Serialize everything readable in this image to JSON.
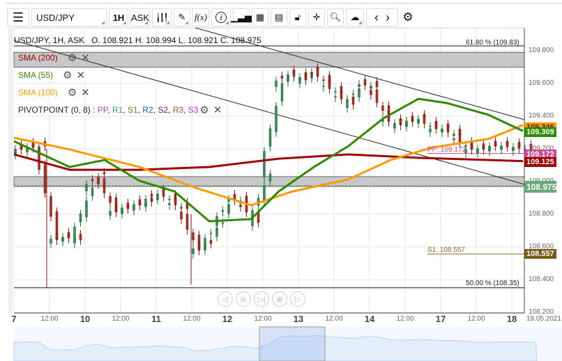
{
  "toolbar": {
    "menu_icon": "hamburger-icon",
    "symbol": "USD/JPY",
    "timeframe": "1H",
    "price_side": "ASK",
    "icons": [
      "candle-type-icon",
      "draw-pencil-icon",
      "function-fx-icon",
      "info-icon",
      "volume-bars-icon",
      "calendar-icon",
      "report-icon",
      "lock-icon",
      "crosshair-icon",
      "zoom-search-icon",
      "cloud-upload-icon",
      "chevron-left-icon",
      "chevron-right-icon",
      "gear-icon"
    ],
    "fx_label": "f(x)",
    "info_label": "i"
  },
  "header": {
    "text": "USD/JPY, 1H, ASK   O. 108.921 H. 108.994 L. 108.921 C. 108.975"
  },
  "indicators": [
    {
      "label": "SMA (200)",
      "color": "#a00000"
    },
    {
      "label": "SMA (55)",
      "color": "#2e8b00"
    },
    {
      "label": "SMA (100)",
      "color": "#ff9900"
    }
  ],
  "pivot": {
    "label": "PIVOTPOINT (0, 8)",
    "sep": " : ",
    "items": [
      {
        "t": "PP",
        "c": "#d040a0"
      },
      {
        "t": "R1",
        "c": "#2aa070"
      },
      {
        "t": "S1",
        "c": "#8a6a20"
      },
      {
        "t": "R2",
        "c": "#2050c0"
      },
      {
        "t": "S2",
        "c": "#602060"
      },
      {
        "t": "R3",
        "c": "#a06020"
      },
      {
        "t": "S3",
        "c": "#d020d0"
      }
    ]
  },
  "fib": {
    "top": "61.80 % (109.83)",
    "bottom": "50.00 % (108.35)"
  },
  "pivot_labels": {
    "pp": "PP: 109.172",
    "s1": "S1: 108.557"
  },
  "price_tags": [
    {
      "v": "109.346",
      "c": "#ff9900",
      "fg": "#333"
    },
    {
      "v": "109.309",
      "c": "#2e8b00",
      "fg": "#fff"
    },
    {
      "v": "109.172",
      "c": "#c84896",
      "fg": "#fff"
    },
    {
      "v": "109.125",
      "c": "#a00000",
      "fg": "#fff"
    },
    {
      "v": "108.975",
      "c": "#6aa87a",
      "fg": "#fff"
    },
    {
      "v": "108.557",
      "c": "#7a5a1a",
      "fg": "#fff"
    }
  ],
  "y_ticks": [
    "109.800",
    "109.600",
    "109.400",
    "109.200",
    "109.000",
    "108.800",
    "108.600",
    "108.400",
    "108.200"
  ],
  "x_ticks": [
    {
      "t": "7",
      "d": true
    },
    {
      "t": "12:00"
    },
    {
      "t": "10",
      "d": true
    },
    {
      "t": "12:00"
    },
    {
      "t": "11",
      "d": true
    },
    {
      "t": "12:00"
    },
    {
      "t": "12",
      "d": true
    },
    {
      "t": "12:00"
    },
    {
      "t": "13",
      "d": true
    },
    {
      "t": "12:00"
    },
    {
      "t": "14",
      "d": true
    },
    {
      "t": "12:00"
    },
    {
      "t": "17",
      "d": true
    },
    {
      "t": "12:00"
    },
    {
      "t": "18",
      "d": true
    },
    {
      "t": "18.05.2021"
    }
  ],
  "navigation": [
    "scroll-left-icon",
    "zoom-out-icon",
    "reset-end-icon",
    "zoom-in-icon",
    "scroll-right-icon"
  ],
  "chart_data": {
    "type": "candlestick",
    "symbol": "USD/JPY",
    "timeframe": "1H",
    "ylim": [
      108.2,
      109.85
    ],
    "step_hours": 4,
    "closes": [
      109.196,
      109.208,
      109.217,
      108.643,
      108.664,
      108.643,
      108.962,
      109.047,
      108.813,
      108.834,
      108.855,
      108.877,
      108.94,
      108.877,
      108.834,
      108.579,
      108.621,
      108.749,
      108.898,
      108.877,
      108.749,
      109.047,
      109.6,
      109.664,
      109.621,
      109.685,
      109.6,
      109.536,
      109.472,
      109.6,
      109.579,
      109.387,
      109.345,
      109.366,
      109.387,
      109.323,
      109.323,
      109.281,
      109.196,
      109.196,
      109.217,
      109.217,
      109.208,
      109.196
    ],
    "sma200": [
      [
        0,
        109.166
      ],
      [
        18.8,
        109.072
      ],
      [
        42.4,
        109.072
      ],
      [
        65.9,
        109.089
      ],
      [
        89.4,
        109.14
      ],
      [
        112.9,
        109.166
      ],
      [
        136.5,
        109.145
      ],
      [
        171.8,
        109.125
      ]
    ],
    "sma55": [
      [
        0,
        109.247
      ],
      [
        18.8,
        109.089
      ],
      [
        30.6,
        109.132
      ],
      [
        42.4,
        109.004
      ],
      [
        54.1,
        108.94
      ],
      [
        65.9,
        108.757
      ],
      [
        80,
        108.77
      ],
      [
        89.4,
        108.94
      ],
      [
        101.2,
        109.089
      ],
      [
        112.9,
        109.217
      ],
      [
        124.7,
        109.387
      ],
      [
        136.5,
        109.506
      ],
      [
        145.9,
        109.481
      ],
      [
        160,
        109.409
      ],
      [
        171.8,
        109.309
      ]
    ],
    "sma100": [
      [
        0,
        109.268
      ],
      [
        18.8,
        109.196
      ],
      [
        42.4,
        109.089
      ],
      [
        61.2,
        108.962
      ],
      [
        80,
        108.855
      ],
      [
        94.1,
        108.94
      ],
      [
        112.9,
        109.013
      ],
      [
        127.1,
        109.132
      ],
      [
        141.2,
        109.209
      ],
      [
        160,
        109.26
      ],
      [
        171.8,
        109.346
      ]
    ],
    "levels": {
      "fib_61_8": 109.83,
      "fib_50": 108.35,
      "pp": 109.172,
      "s1": 108.557,
      "last": 108.975
    },
    "zones": [
      [
        109.7,
        109.79
      ],
      [
        108.97,
        109.03
      ]
    ]
  }
}
